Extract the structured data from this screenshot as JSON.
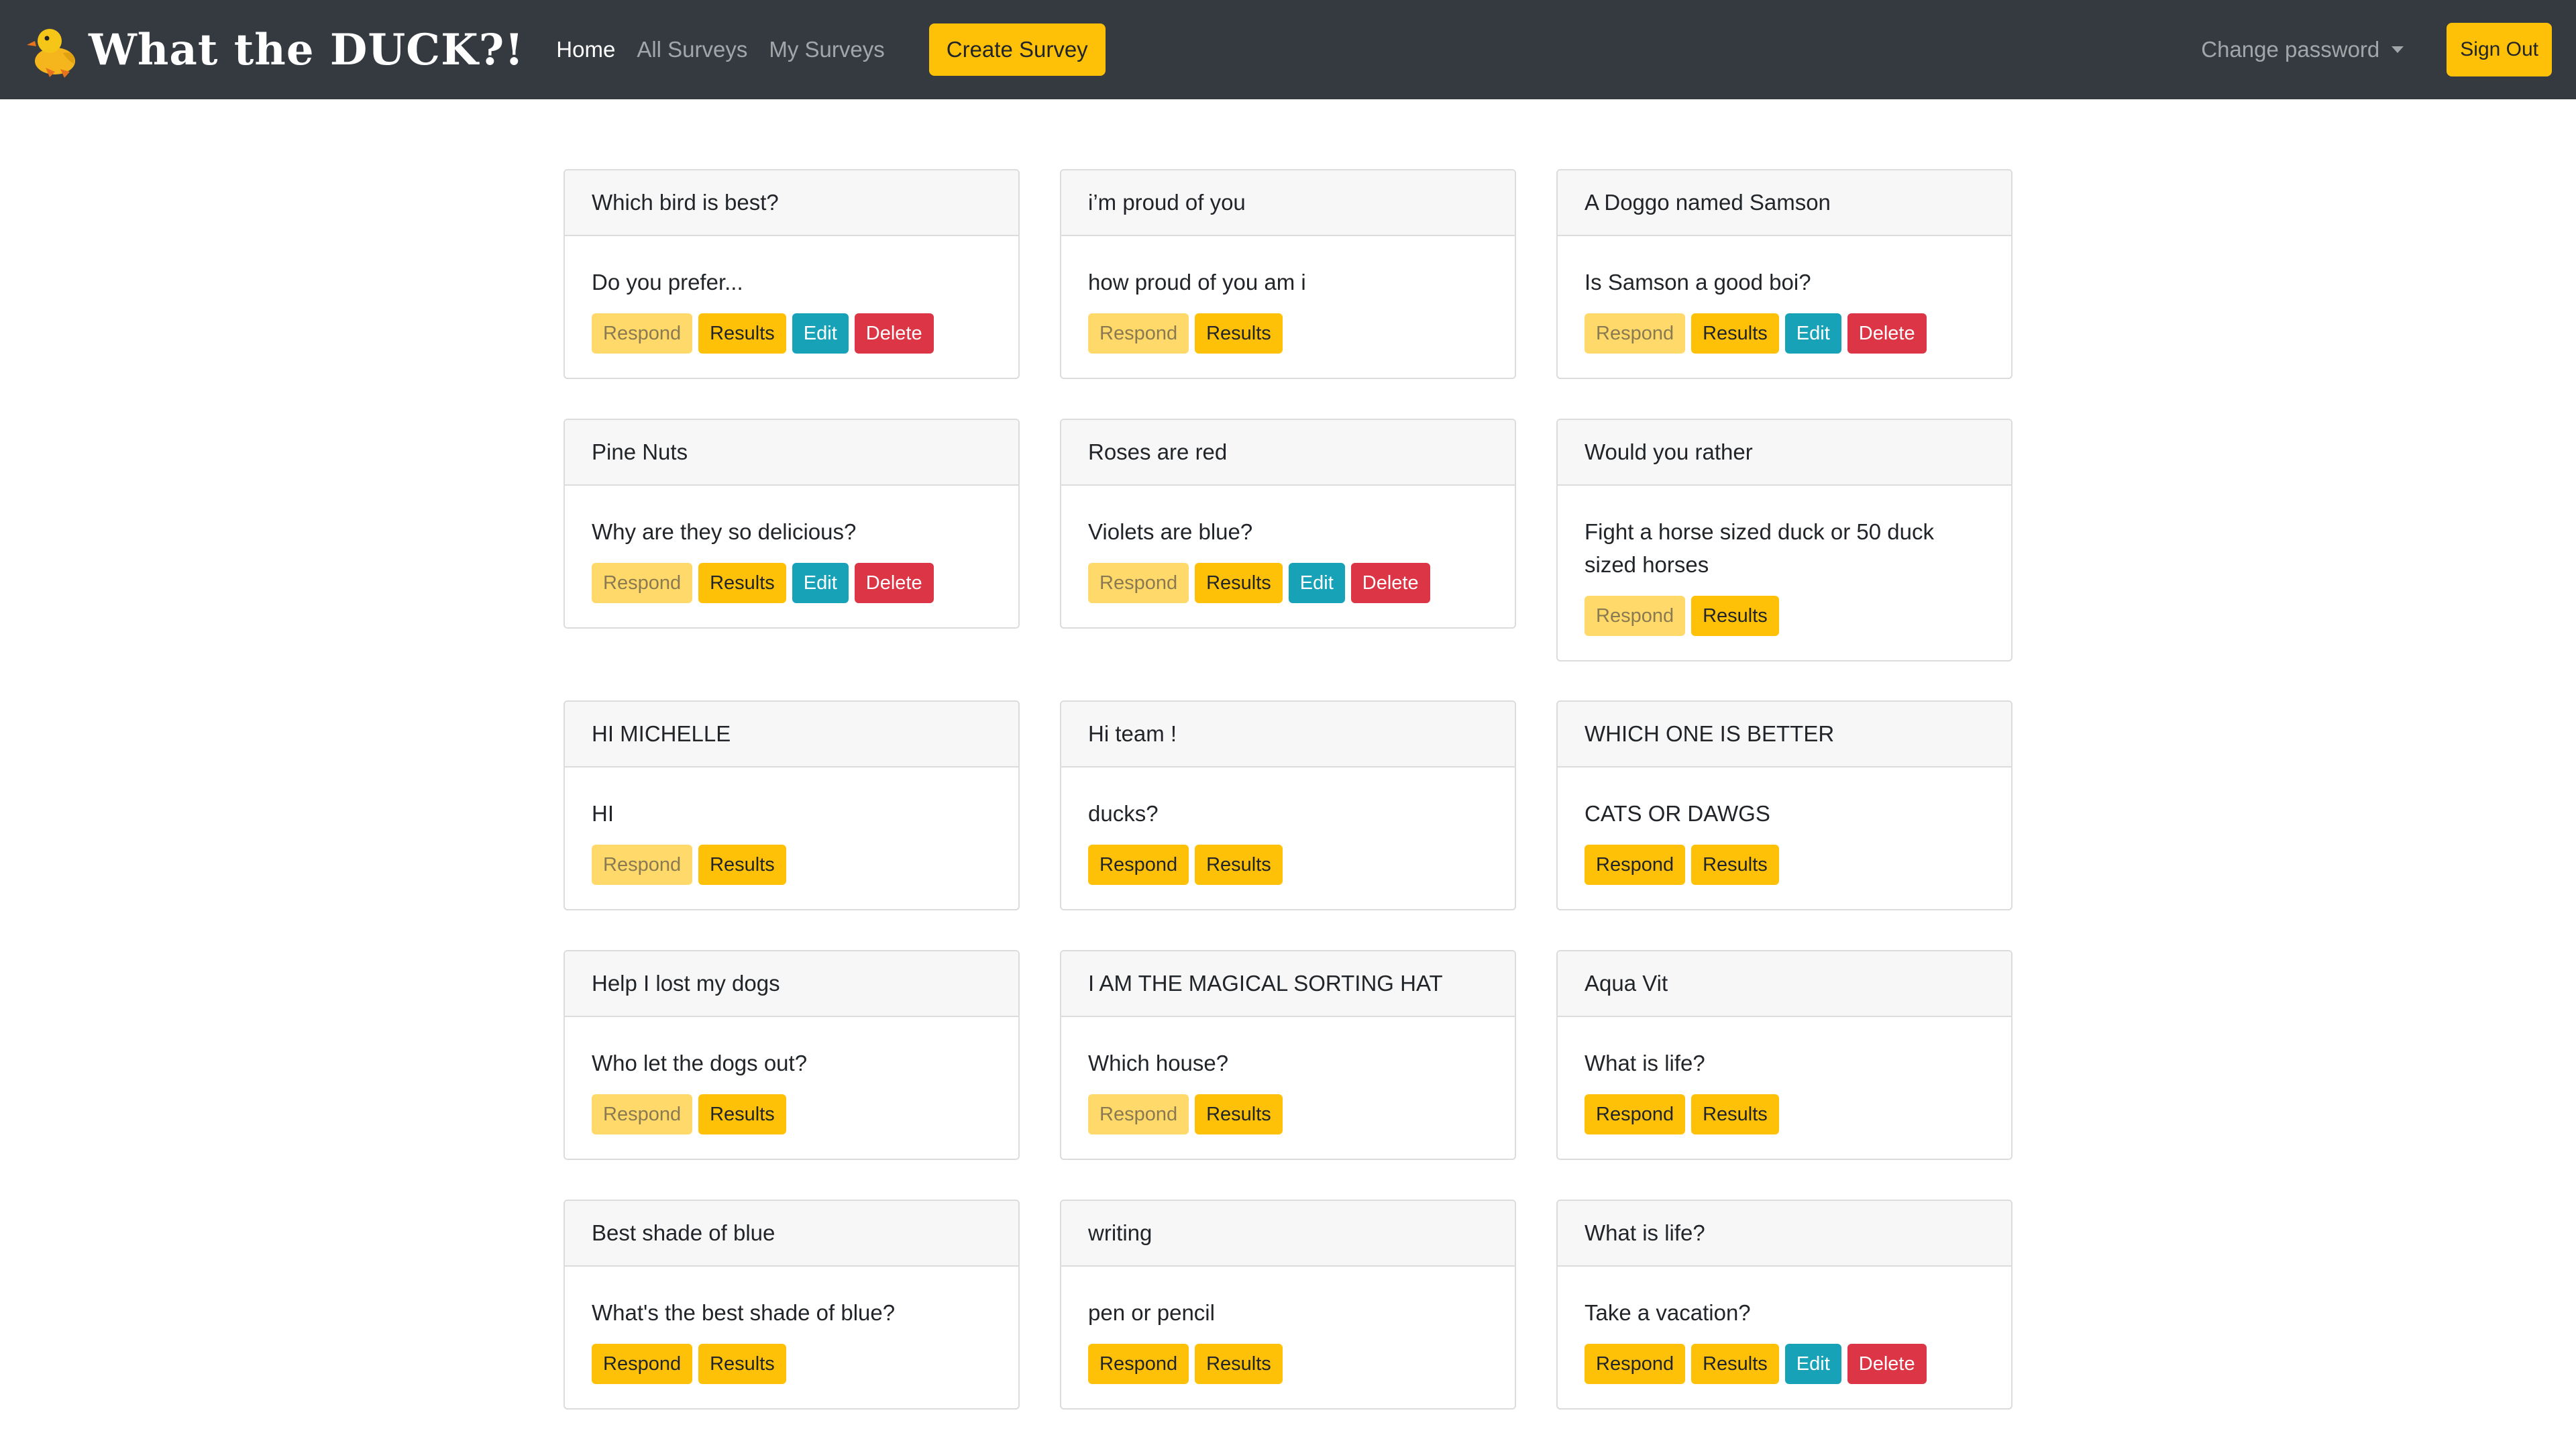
{
  "navbar": {
    "brand": "What the DUCK?!",
    "links": [
      "Home",
      "All Surveys",
      "My Surveys"
    ],
    "create_label": "Create Survey",
    "dropdown_label": "Change password",
    "signout_label": "Sign Out"
  },
  "buttons": {
    "respond": "Respond",
    "results": "Results",
    "edit": "Edit",
    "delete": "Delete"
  },
  "colors": {
    "navbar": "#343a40",
    "accent": "#ffc107",
    "edit": "#17a2b8",
    "delete": "#dc3545"
  },
  "surveys": [
    {
      "title": "Which bird is best?",
      "question": "Do you prefer...",
      "respond_enabled": false,
      "can_edit": true
    },
    {
      "title": "i’m proud of you",
      "question": "how proud of you am i",
      "respond_enabled": false,
      "can_edit": false
    },
    {
      "title": "A Doggo named Samson",
      "question": "Is Samson a good boi?",
      "respond_enabled": false,
      "can_edit": true
    },
    {
      "title": "Pine Nuts",
      "question": "Why are they so delicious?",
      "respond_enabled": false,
      "can_edit": true
    },
    {
      "title": "Roses are red",
      "question": "Violets are blue?",
      "respond_enabled": false,
      "can_edit": true
    },
    {
      "title": "Would you rather",
      "question": "Fight a horse sized duck or 50 duck sized horses",
      "respond_enabled": false,
      "can_edit": false
    },
    {
      "title": "HI MICHELLE",
      "question": "HI",
      "respond_enabled": false,
      "can_edit": false
    },
    {
      "title": "Hi team !",
      "question": "ducks?",
      "respond_enabled": true,
      "can_edit": false
    },
    {
      "title": "WHICH ONE IS BETTER",
      "question": "CATS OR DAWGS",
      "respond_enabled": true,
      "can_edit": false
    },
    {
      "title": "Help I lost my dogs",
      "question": "Who let the dogs out?",
      "respond_enabled": false,
      "can_edit": false
    },
    {
      "title": "I AM THE MAGICAL SORTING HAT",
      "question": "Which house?",
      "respond_enabled": false,
      "can_edit": false
    },
    {
      "title": "Aqua Vit",
      "question": "What is life?",
      "respond_enabled": true,
      "can_edit": false
    },
    {
      "title": "Best shade of blue",
      "question": "What's the best shade of blue?",
      "respond_enabled": true,
      "can_edit": false
    },
    {
      "title": "writing",
      "question": "pen or pencil",
      "respond_enabled": true,
      "can_edit": false
    },
    {
      "title": "What is life?",
      "question": "Take a vacation?",
      "respond_enabled": true,
      "can_edit": true
    }
  ]
}
